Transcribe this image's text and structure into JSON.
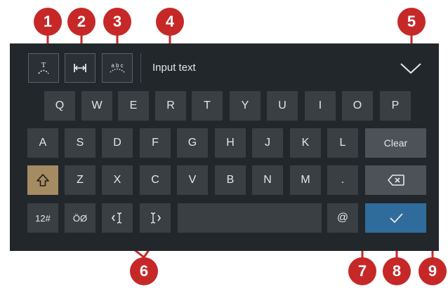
{
  "toolbar": {
    "input_text": "Input text"
  },
  "keys": {
    "row1": [
      "Q",
      "W",
      "E",
      "R",
      "T",
      "Y",
      "U",
      "I",
      "O",
      "P"
    ],
    "row2": [
      "A",
      "S",
      "D",
      "F",
      "G",
      "H",
      "J",
      "K",
      "L"
    ],
    "clear_label": "Clear",
    "row3": [
      "Z",
      "X",
      "C",
      "V",
      "B",
      "N",
      "M",
      "."
    ],
    "numbers_label": "12#",
    "special_label": "ÖØ",
    "at_label": "@"
  },
  "callouts": [
    "1",
    "2",
    "3",
    "4",
    "5",
    "6",
    "7",
    "8",
    "9"
  ],
  "colors": {
    "panel": "#22272c",
    "key": "#3a3f44",
    "shift": "#a58b62",
    "confirm": "#2f6c9c",
    "callout": "#c62828"
  }
}
